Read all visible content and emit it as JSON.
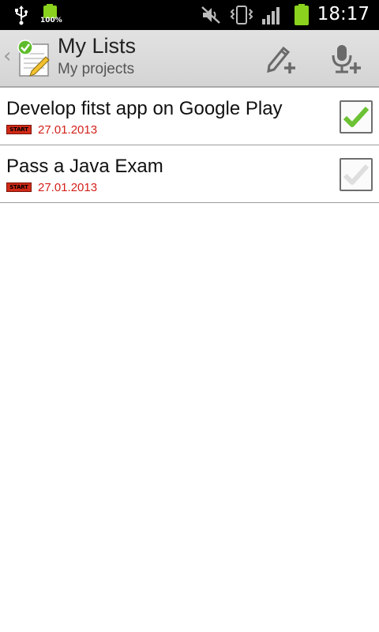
{
  "status_bar": {
    "battery_small_label": "100%",
    "time": "18:17",
    "icons": [
      "usb-icon",
      "battery-full-icon",
      "mute-icon",
      "vibrate-icon",
      "signal-icon",
      "battery-icon"
    ]
  },
  "action_bar": {
    "title": "My Lists",
    "subtitle": "My projects",
    "actions": [
      "add-edit-icon",
      "add-voice-icon"
    ]
  },
  "list": {
    "items": [
      {
        "title": "Develop fitst app on Google Play",
        "tag": "START",
        "date": "27.01.2013",
        "checked": true
      },
      {
        "title": "Pass a Java Exam",
        "tag": "START",
        "date": "27.01.2013",
        "checked": false
      }
    ]
  },
  "colors": {
    "accent_green": "#6cc234",
    "date_red": "#d4211a",
    "tag_red": "#d02a17"
  }
}
